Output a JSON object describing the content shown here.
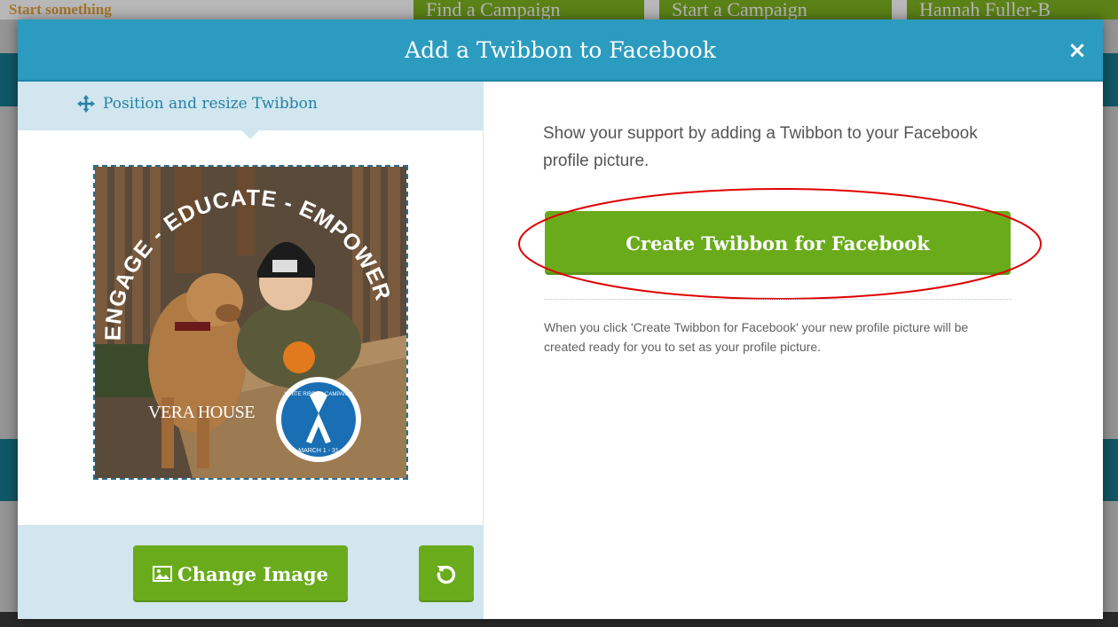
{
  "background": {
    "tagline": "Start something",
    "nav": [
      "Find a Campaign",
      "Start a Campaign",
      "Hannah Fuller-B"
    ]
  },
  "modal": {
    "title": "Add a Twibbon to Facebook",
    "close_glyph": "×",
    "left": {
      "tab_label": "Position and resize Twibbon",
      "tab_icon": "move-icon",
      "preview": {
        "arc_text": "ENGAGE - EDUCATE - EMPOWER",
        "brand_logo": "VERA HOUSE",
        "badge_top": "WHITE RIBBON CAMPAIGN",
        "badge_bottom": "MARCH 1 - 31"
      },
      "change_image_label": "Change Image",
      "change_image_icon": "image-icon",
      "reset_icon": "reset-icon"
    },
    "right": {
      "support_text": "Show your support by adding a Twibbon to your Facebook profile picture.",
      "create_button_label": "Create Twibbon for Facebook",
      "help_text": "When you click 'Create Twibbon for Facebook' your new profile picture will be created ready for you to set as your profile picture."
    }
  },
  "colors": {
    "header": "#2b9bbf",
    "button_green": "#6aab1c",
    "panel_light_blue": "#d1e6ee",
    "highlight_red": "#e00000"
  }
}
